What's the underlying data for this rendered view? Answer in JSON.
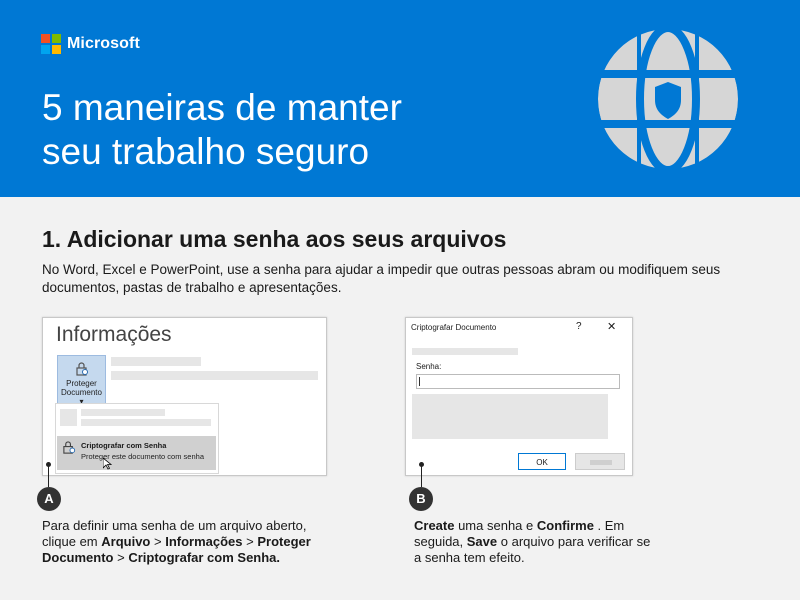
{
  "brand": {
    "name": "Microsoft",
    "colors": [
      "#f25022",
      "#7fba00",
      "#00a4ef",
      "#ffb900"
    ]
  },
  "hero": {
    "title_line1": "5 maneiras de manter",
    "title_line2": "seu trabalho seguro",
    "background": "#0078d4",
    "icon": "globe-shield-icon"
  },
  "section": {
    "title": "1. Adicionar uma senha aos seus arquivos",
    "description": "No Word, Excel e PowerPoint, use a senha para ajudar a impedir que outras pessoas abram ou modifiquem seus documentos, pastas de trabalho e apresentações."
  },
  "screenshot_a": {
    "heading": "Informações",
    "tile_label_1": "Proteger",
    "tile_label_2": "Documento",
    "menu_item_title": "Criptografar com Senha",
    "menu_item_sub": "Proteger este documento com senha"
  },
  "screenshot_b": {
    "dialog_title": "Criptografar Documento",
    "help": "?",
    "close": "✕",
    "field_label": "Senha:",
    "ok_label": "OK"
  },
  "step_a": {
    "badge": "A",
    "text_1": "Para definir uma senha de um arquivo aberto, clique em ",
    "bold_1": "Arquivo",
    "text_2": " > ",
    "bold_2": "Informações",
    "text_3": " > ",
    "bold_3": "Proteger Documento",
    "text_4": " > ",
    "bold_4": "Criptografar com Senha."
  },
  "step_b": {
    "badge": "B",
    "bold_1": "Create",
    "text_1": " uma senha e ",
    "bold_2": "Confirme",
    "text_2": " . Em seguida, ",
    "bold_3": "Save",
    "text_3": " o arquivo para verificar se a senha tem efeito."
  }
}
